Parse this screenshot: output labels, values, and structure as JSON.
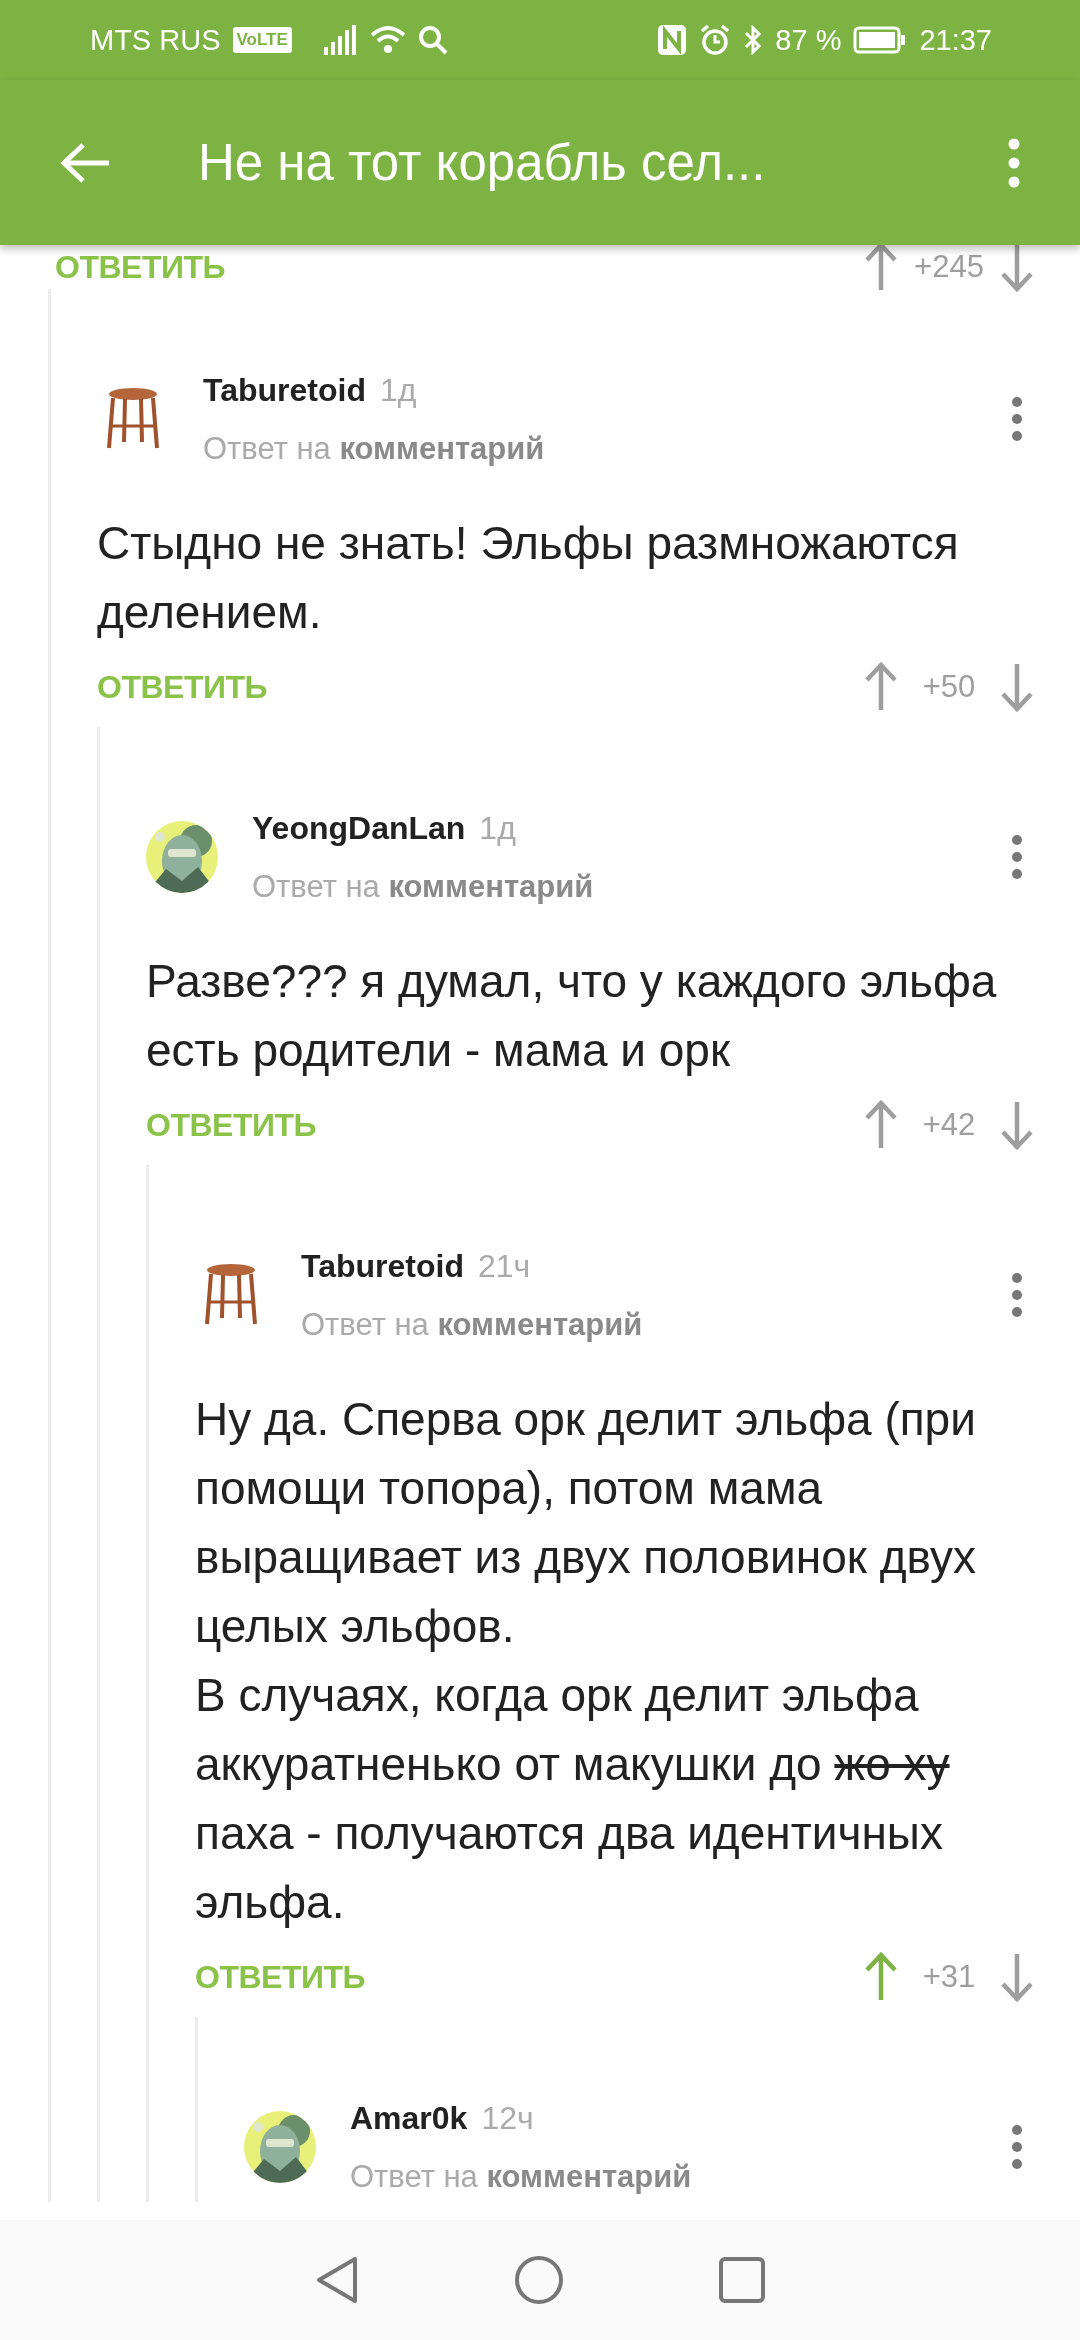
{
  "status_bar": {
    "carrier": "MTS RUS",
    "network_badge": "VoLTE",
    "battery": "87 %",
    "time": "21:37"
  },
  "app_bar": {
    "title": "Не на тот корабль сел..."
  },
  "parent_actions": {
    "reply": "ОТВЕТИТЬ",
    "score": "+245",
    "upvoted": false
  },
  "comments": [
    {
      "author": "Taburetoid",
      "avatar": {
        "kind": "stool"
      },
      "time": "1д",
      "reply_to": "Ответ на **комментарий**",
      "body": [
        [
          {
            "text": "Стыдно не знать! Эльфы размножаются делением.",
            "strike": false
          }
        ]
      ],
      "reply": "ОТВЕТИТЬ",
      "score": "+50",
      "upvoted": false,
      "children": [
        {
          "author": "YeongDanLan",
          "avatar": {
            "kind": "picture"
          },
          "time": "1д",
          "reply_to": "Ответ на **комментарий**",
          "body": [
            [
              {
                "text": "Разве??? я думал, что у каждого эльфа есть родители - мама и орк",
                "strike": false
              }
            ]
          ],
          "reply": "ОТВЕТИТЬ",
          "score": "+42",
          "upvoted": false,
          "children": [
            {
              "author": "Taburetoid",
              "avatar": {
                "kind": "stool"
              },
              "time": "21ч",
              "reply_to": "Ответ на **комментарий**",
              "body": [
                [
                  {
                    "text": "Ну да. Сперва орк делит эльфа (при помощи топора), потом мама выращивает из двух половинок двух целых эльфов.",
                    "strike": false
                  }
                ],
                [
                  {
                    "text": "В случаях, когда орк делит эльфа аккуратненько от макушки до ",
                    "strike": false
                  },
                  {
                    "text": "жо ху",
                    "strike": true
                  },
                  {
                    "text": " паха - получаются два идентичных эльфа.",
                    "strike": false
                  }
                ]
              ],
              "reply": "ОТВЕТИТЬ",
              "score": "+31",
              "upvoted": true,
              "children": [
                {
                  "author": "Amar0k",
                  "avatar": {
                    "kind": "picture"
                  },
                  "time": "12ч",
                  "reply_to": "Ответ на **комментарий**"
                }
              ]
            }
          ]
        }
      ]
    }
  ]
}
